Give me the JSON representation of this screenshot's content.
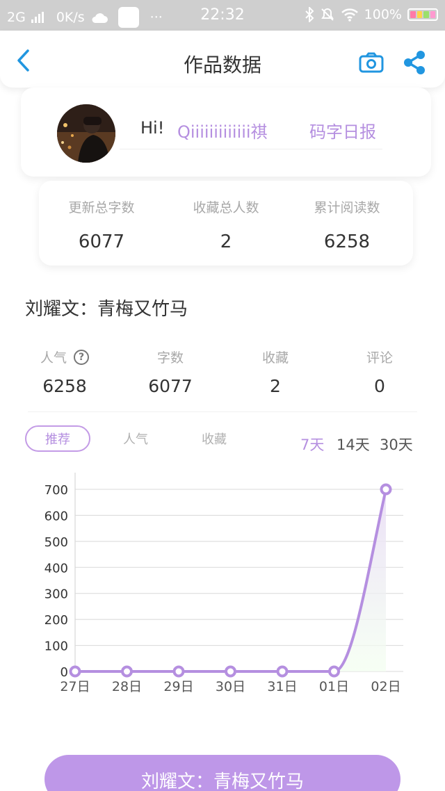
{
  "status_bar": {
    "network": "2G",
    "speed": "0K/s",
    "more": "···",
    "time": "22:32",
    "battery": "100%"
  },
  "nav": {
    "title": "作品数据",
    "back_icon": "chevron-left-icon",
    "camera_icon": "camera-icon",
    "share_icon": "share-icon",
    "accent_color": "#2196e0"
  },
  "profile": {
    "greeting": "Hi!",
    "username": "Qiiiiiiiiiiiii祺",
    "daily_report_label": "码字日报"
  },
  "summary": [
    {
      "label": "更新总字数",
      "value": "6077"
    },
    {
      "label": "收藏总人数",
      "value": "2"
    },
    {
      "label": "累计阅读数",
      "value": "6258"
    }
  ],
  "work": {
    "title": "刘耀文：青梅又竹马",
    "stats": [
      {
        "label": "人气",
        "value": "6258"
      },
      {
        "label": "字数",
        "value": "6077"
      },
      {
        "label": "收藏",
        "value": "2"
      },
      {
        "label": "评论",
        "value": "0"
      }
    ]
  },
  "metric_tabs": [
    "推荐",
    "人气",
    "收藏"
  ],
  "active_metric_tab": "推荐",
  "range_tabs": [
    "7天",
    "14天",
    "30天"
  ],
  "active_range_tab": "7天",
  "chart_data": {
    "type": "line",
    "categories": [
      "27日",
      "28日",
      "29日",
      "30日",
      "31日",
      "01日",
      "02日"
    ],
    "values": [
      0,
      0,
      0,
      0,
      0,
      0,
      700
    ],
    "ylim": [
      0,
      700
    ],
    "yticks": [
      0,
      100,
      200,
      300,
      400,
      500,
      600,
      700
    ],
    "grid": true,
    "line_color": "#b58fe0",
    "fill_color": "#e9dcf6"
  },
  "bottom_button": {
    "label": "刘耀文：青梅又竹马"
  },
  "colors": {
    "accent": "#b58fe0",
    "button": "#be97e8"
  }
}
